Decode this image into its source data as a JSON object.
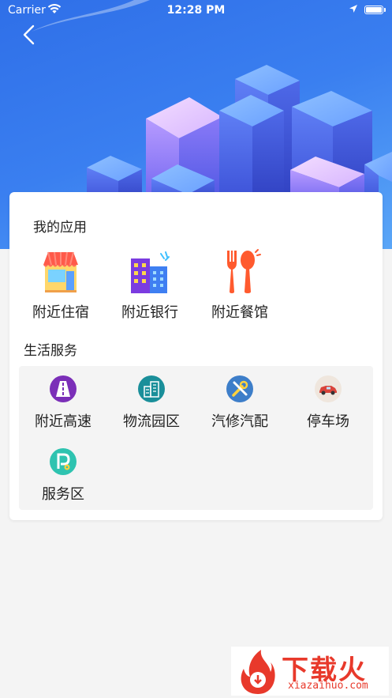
{
  "status_bar": {
    "carrier": "Carrier",
    "time": "12:28 PM",
    "wifi_icon": "wifi-icon",
    "location_icon": "location-arrow-icon",
    "battery_icon": "battery-icon"
  },
  "nav": {
    "back_icon": "chevron-left-icon"
  },
  "my_apps": {
    "title": "我的应用",
    "items": [
      {
        "label": "附近住宿",
        "icon": "shop-icon"
      },
      {
        "label": "附近银行",
        "icon": "buildings-icon"
      },
      {
        "label": "附近餐馆",
        "icon": "fork-spoon-icon"
      }
    ]
  },
  "life_services": {
    "title": "生活服务",
    "items": [
      {
        "label": "附近高速",
        "icon": "road-icon",
        "color": "#7b2fb8"
      },
      {
        "label": "物流园区",
        "icon": "buildings-icon",
        "color": "#1a8f9a"
      },
      {
        "label": "汽修汽配",
        "icon": "wrench-screwdriver-icon",
        "color": "#3d7ec9"
      },
      {
        "label": "停车场",
        "icon": "car-icon",
        "color": "#efe6dd"
      },
      {
        "label": "服务区",
        "icon": "parking-icon",
        "color": "#2ec3b0"
      }
    ]
  },
  "watermark": {
    "text": "下载火",
    "url": "xiazaihuo.com",
    "color": "#e8392b"
  }
}
